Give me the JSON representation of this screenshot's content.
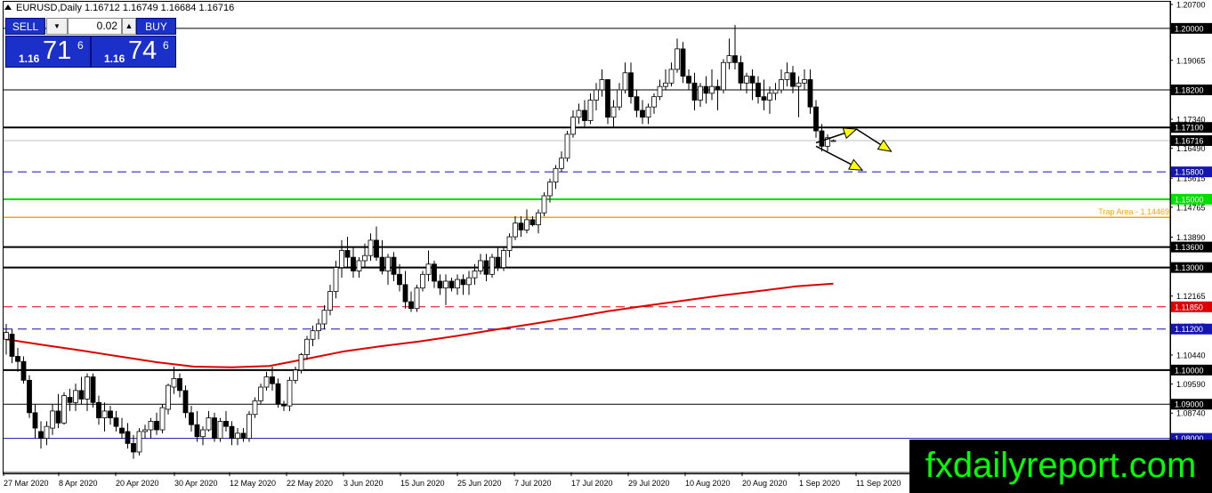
{
  "header": {
    "title": "EURUSD,Daily  1.16712 1.16749 1.16684 1.16716"
  },
  "trade_panel": {
    "sell_label": "SELL",
    "buy_label": "BUY",
    "volume": "0.02",
    "sell_price": {
      "prefix": "1.16",
      "big": "71",
      "sup": "6"
    },
    "buy_price": {
      "prefix": "1.16",
      "big": "74",
      "sup": "6"
    }
  },
  "watermark": "fxdailyreport.com",
  "colors": {
    "candle_stroke": "#000000",
    "ma_line": "#dd0000",
    "green_level": "#00dd00",
    "orange_level": "#ffa500",
    "red_dashed": "#dd0000",
    "blue_dashed": "#1010aa",
    "blue_solid": "#1515b0",
    "current_price_line": "#c0c0c0",
    "arrow_head": "#ffff00",
    "panel_blue": "#1a30c8"
  },
  "chart_data": {
    "type": "candlestick",
    "symbol": "EURUSD",
    "timeframe": "Daily",
    "ylim": [
      1.07,
      1.207
    ],
    "y_ticks": [
      "1.20700",
      "1.19065",
      "1.17340",
      "1.16490",
      "1.15615",
      "1.14765",
      "1.13890",
      "1.12165",
      "1.11285",
      "1.10440",
      "1.09590",
      "1.08740",
      "1.07865"
    ],
    "x_ticks": [
      "27 Mar 2020",
      "8 Apr 2020",
      "20 Apr 2020",
      "30 Apr 2020",
      "12 May 2020",
      "22 May 2020",
      "3 Jun 2020",
      "15 Jun 2020",
      "25 Jun 2020",
      "7 Jul 2020",
      "17 Jul 2020",
      "29 Jul 2020",
      "10 Aug 2020",
      "20 Aug 2020",
      "1 Sep 2020",
      "11 Sep 2020"
    ],
    "levels": [
      {
        "value": 1.2,
        "label": "1.20000",
        "style": "solid",
        "color": "#000000",
        "width": 1,
        "tag_bg": "#000000",
        "tag_fg": "#ffffff"
      },
      {
        "value": 1.182,
        "label": "1.18200",
        "style": "solid",
        "color": "#000000",
        "width": 1,
        "tag_bg": "#000000",
        "tag_fg": "#ffffff"
      },
      {
        "value": 1.171,
        "label": "1.17100",
        "style": "solid",
        "color": "#000000",
        "width": 2,
        "tag_bg": "#000000",
        "tag_fg": "#ffffff"
      },
      {
        "value": 1.16716,
        "label": "1.16716",
        "style": "solid",
        "color": "#c0c0c0",
        "width": 1,
        "tag_bg": "#000000",
        "tag_fg": "#ffffff"
      },
      {
        "value": 1.158,
        "label": "1.15800",
        "style": "dashed",
        "color": "#1010aa",
        "width": 1,
        "tag_bg": "#1515b0",
        "tag_fg": "#ffffff"
      },
      {
        "value": 1.15,
        "label": "1.15000",
        "style": "solid",
        "color": "#00dd00",
        "width": 2,
        "tag_bg": "#00dd00",
        "tag_fg": "#ffffff"
      },
      {
        "value": 1.14469,
        "label": "",
        "style": "solid",
        "color": "#ffa500",
        "width": 1.5,
        "tag_bg": "",
        "tag_fg": ""
      },
      {
        "value": 1.136,
        "label": "1.13600",
        "style": "solid",
        "color": "#000000",
        "width": 2,
        "tag_bg": "#000000",
        "tag_fg": "#ffffff"
      },
      {
        "value": 1.13,
        "label": "1.13000",
        "style": "solid",
        "color": "#000000",
        "width": 2,
        "tag_bg": "#000000",
        "tag_fg": "#ffffff"
      },
      {
        "value": 1.1185,
        "label": "1.11850",
        "style": "dashed",
        "color": "#dd0000",
        "width": 1,
        "tag_bg": "#dd0000",
        "tag_fg": "#ffffff"
      },
      {
        "value": 1.112,
        "label": "1.11200",
        "style": "dashed",
        "color": "#1010aa",
        "width": 1,
        "tag_bg": "#1515b0",
        "tag_fg": "#ffffff"
      },
      {
        "value": 1.1,
        "label": "1.10000",
        "style": "solid",
        "color": "#000000",
        "width": 2,
        "tag_bg": "#000000",
        "tag_fg": "#ffffff"
      },
      {
        "value": 1.09,
        "label": "1.09000",
        "style": "solid",
        "color": "#000000",
        "width": 1,
        "tag_bg": "#000000",
        "tag_fg": "#ffffff"
      },
      {
        "value": 1.08,
        "label": "1.08000",
        "style": "solid",
        "color": "#1515b0",
        "width": 1,
        "tag_bg": "#1515b0",
        "tag_fg": "#ffffff"
      }
    ],
    "annotation": {
      "text": "Trap Area - 1.14469",
      "color": "#ffa500"
    },
    "candles": [
      [
        1.109,
        1.1135,
        1.1045,
        1.111
      ],
      [
        1.1105,
        1.112,
        1.102,
        1.104
      ],
      [
        1.104,
        1.1065,
        1.0995,
        1.1025
      ],
      [
        1.1025,
        1.104,
        1.096,
        1.097
      ],
      [
        1.097,
        1.0985,
        1.086,
        1.0875
      ],
      [
        1.0875,
        1.09,
        1.08,
        1.083
      ],
      [
        1.082,
        1.085,
        1.077,
        1.08
      ],
      [
        1.08,
        1.085,
        1.078,
        1.0835
      ],
      [
        1.083,
        1.09,
        1.081,
        1.088
      ],
      [
        1.088,
        1.093,
        1.083,
        1.0845
      ],
      [
        1.0845,
        1.0935,
        1.084,
        1.0925
      ],
      [
        1.092,
        1.0945,
        1.088,
        1.0905
      ],
      [
        1.0905,
        1.096,
        1.088,
        1.094
      ],
      [
        1.094,
        1.098,
        1.09,
        1.0915
      ],
      [
        1.0915,
        1.099,
        1.088,
        1.098
      ],
      [
        1.098,
        1.099,
        1.089,
        1.0905
      ],
      [
        1.0905,
        1.0925,
        1.084,
        1.086
      ],
      [
        1.086,
        1.0905,
        1.082,
        1.088
      ],
      [
        1.088,
        1.0895,
        1.084,
        1.086
      ],
      [
        1.086,
        1.088,
        1.082,
        1.0835
      ],
      [
        1.083,
        1.086,
        1.08,
        1.0815
      ],
      [
        1.082,
        1.0845,
        1.077,
        1.0785
      ],
      [
        1.0785,
        1.081,
        1.074,
        1.076
      ],
      [
        1.076,
        1.083,
        1.075,
        1.082
      ],
      [
        1.082,
        1.084,
        1.08,
        1.0825
      ],
      [
        1.0825,
        1.086,
        1.08,
        1.085
      ],
      [
        1.085,
        1.0875,
        1.081,
        1.0825
      ],
      [
        1.0825,
        1.09,
        1.0815,
        1.089
      ],
      [
        1.0885,
        1.096,
        1.087,
        1.0955
      ],
      [
        1.095,
        1.101,
        1.093,
        1.0975
      ],
      [
        1.0975,
        1.099,
        1.092,
        1.094
      ],
      [
        1.094,
        1.0955,
        1.086,
        1.0875
      ],
      [
        1.0875,
        1.0895,
        1.082,
        1.084
      ],
      [
        1.084,
        1.088,
        1.079,
        1.0805
      ],
      [
        1.0805,
        1.0835,
        1.078,
        1.0825
      ],
      [
        1.0825,
        1.088,
        1.082,
        1.086
      ],
      [
        1.086,
        1.0875,
        1.079,
        1.08
      ],
      [
        1.08,
        1.086,
        1.079,
        1.085
      ],
      [
        1.085,
        1.088,
        1.082,
        1.0835
      ],
      [
        1.0835,
        1.085,
        1.078,
        1.08
      ],
      [
        1.08,
        1.083,
        1.078,
        1.0815
      ],
      [
        1.0815,
        1.083,
        1.079,
        1.08
      ],
      [
        1.08,
        1.088,
        1.079,
        1.087
      ],
      [
        1.087,
        1.092,
        1.086,
        1.091
      ],
      [
        1.091,
        1.096,
        1.09,
        1.095
      ],
      [
        1.095,
        1.0995,
        1.094,
        1.098
      ],
      [
        1.098,
        1.101,
        1.094,
        1.096
      ],
      [
        1.096,
        1.0975,
        1.089,
        1.09
      ],
      [
        1.09,
        1.091,
        1.088,
        1.0895
      ],
      [
        1.0895,
        1.098,
        1.088,
        1.097
      ],
      [
        1.097,
        1.101,
        1.096,
        1.1
      ],
      [
        1.1,
        1.105,
        1.099,
        1.1045
      ],
      [
        1.1045,
        1.11,
        1.103,
        1.109
      ],
      [
        1.109,
        1.113,
        1.107,
        1.1115
      ],
      [
        1.1115,
        1.115,
        1.109,
        1.1135
      ],
      [
        1.1135,
        1.119,
        1.112,
        1.1175
      ],
      [
        1.1175,
        1.125,
        1.116,
        1.123
      ],
      [
        1.123,
        1.132,
        1.121,
        1.13
      ],
      [
        1.13,
        1.138,
        1.127,
        1.135
      ],
      [
        1.135,
        1.139,
        1.13,
        1.133
      ],
      [
        1.133,
        1.136,
        1.127,
        1.129
      ],
      [
        1.129,
        1.133,
        1.127,
        1.132
      ],
      [
        1.132,
        1.137,
        1.13,
        1.1335
      ],
      [
        1.1335,
        1.14,
        1.132,
        1.138
      ],
      [
        1.138,
        1.142,
        1.132,
        1.133
      ],
      [
        1.133,
        1.138,
        1.128,
        1.129
      ],
      [
        1.129,
        1.134,
        1.125,
        1.133
      ],
      [
        1.133,
        1.1345,
        1.126,
        1.128
      ],
      [
        1.128,
        1.131,
        1.123,
        1.125
      ],
      [
        1.125,
        1.129,
        1.118,
        1.12
      ],
      [
        1.12,
        1.123,
        1.117,
        1.118
      ],
      [
        1.118,
        1.125,
        1.117,
        1.124
      ],
      [
        1.124,
        1.129,
        1.123,
        1.128
      ],
      [
        1.128,
        1.135,
        1.126,
        1.131
      ],
      [
        1.131,
        1.132,
        1.124,
        1.126
      ],
      [
        1.126,
        1.128,
        1.122,
        1.124
      ],
      [
        1.124,
        1.128,
        1.119,
        1.126
      ],
      [
        1.126,
        1.127,
        1.123,
        1.124
      ],
      [
        1.124,
        1.128,
        1.122,
        1.1265
      ],
      [
        1.1265,
        1.128,
        1.122,
        1.125
      ],
      [
        1.125,
        1.129,
        1.122,
        1.127
      ],
      [
        1.127,
        1.131,
        1.125,
        1.129
      ],
      [
        1.129,
        1.134,
        1.128,
        1.132
      ],
      [
        1.132,
        1.134,
        1.126,
        1.128
      ],
      [
        1.128,
        1.134,
        1.127,
        1.133
      ],
      [
        1.133,
        1.136,
        1.129,
        1.13
      ],
      [
        1.13,
        1.136,
        1.129,
        1.135
      ],
      [
        1.135,
        1.14,
        1.133,
        1.139
      ],
      [
        1.139,
        1.145,
        1.138,
        1.143
      ],
      [
        1.143,
        1.145,
        1.139,
        1.141
      ],
      [
        1.141,
        1.147,
        1.14,
        1.144
      ],
      [
        1.144,
        1.145,
        1.142,
        1.1425
      ],
      [
        1.1425,
        1.147,
        1.14,
        1.146
      ],
      [
        1.146,
        1.152,
        1.145,
        1.151
      ],
      [
        1.151,
        1.156,
        1.149,
        1.155
      ],
      [
        1.155,
        1.16,
        1.153,
        1.159
      ],
      [
        1.159,
        1.164,
        1.158,
        1.162
      ],
      [
        1.162,
        1.17,
        1.161,
        1.169
      ],
      [
        1.169,
        1.176,
        1.168,
        1.174
      ],
      [
        1.174,
        1.178,
        1.172,
        1.176
      ],
      [
        1.176,
        1.179,
        1.171,
        1.173
      ],
      [
        1.173,
        1.181,
        1.172,
        1.179
      ],
      [
        1.179,
        1.184,
        1.176,
        1.182
      ],
      [
        1.182,
        1.188,
        1.18,
        1.185
      ],
      [
        1.185,
        1.185,
        1.172,
        1.174
      ],
      [
        1.174,
        1.179,
        1.171,
        1.177
      ],
      [
        1.177,
        1.184,
        1.176,
        1.182
      ],
      [
        1.182,
        1.19,
        1.181,
        1.187
      ],
      [
        1.187,
        1.19,
        1.178,
        1.18
      ],
      [
        1.18,
        1.182,
        1.174,
        1.176
      ],
      [
        1.176,
        1.179,
        1.172,
        1.174
      ],
      [
        1.174,
        1.178,
        1.172,
        1.177
      ],
      [
        1.177,
        1.181,
        1.175,
        1.18
      ],
      [
        1.18,
        1.185,
        1.179,
        1.183
      ],
      [
        1.183,
        1.188,
        1.182,
        1.184
      ],
      [
        1.184,
        1.19,
        1.183,
        1.188
      ],
      [
        1.188,
        1.197,
        1.187,
        1.194
      ],
      [
        1.194,
        1.196,
        1.184,
        1.186
      ],
      [
        1.186,
        1.188,
        1.182,
        1.184
      ],
      [
        1.184,
        1.187,
        1.176,
        1.179
      ],
      [
        1.179,
        1.184,
        1.177,
        1.183
      ],
      [
        1.183,
        1.186,
        1.178,
        1.181
      ],
      [
        1.181,
        1.188,
        1.179,
        1.183
      ],
      [
        1.183,
        1.185,
        1.176,
        1.182
      ],
      [
        1.182,
        1.191,
        1.181,
        1.19
      ],
      [
        1.19,
        1.197,
        1.188,
        1.192
      ],
      [
        1.192,
        1.201,
        1.188,
        1.19
      ],
      [
        1.19,
        1.192,
        1.182,
        1.184
      ],
      [
        1.184,
        1.187,
        1.181,
        1.186
      ],
      [
        1.186,
        1.188,
        1.179,
        1.184
      ],
      [
        1.184,
        1.186,
        1.178,
        1.18
      ],
      [
        1.18,
        1.185,
        1.176,
        1.179
      ],
      [
        1.179,
        1.183,
        1.175,
        1.181
      ],
      [
        1.181,
        1.184,
        1.179,
        1.182
      ],
      [
        1.182,
        1.188,
        1.181,
        1.185
      ],
      [
        1.185,
        1.19,
        1.183,
        1.187
      ],
      [
        1.187,
        1.189,
        1.181,
        1.183
      ],
      [
        1.183,
        1.186,
        1.174,
        1.184
      ],
      [
        1.184,
        1.188,
        1.182,
        1.185
      ],
      [
        1.185,
        1.188,
        1.175,
        1.177
      ],
      [
        1.177,
        1.179,
        1.168,
        1.17
      ],
      [
        1.17,
        1.172,
        1.164,
        1.1655
      ],
      [
        1.1655,
        1.169,
        1.164,
        1.168
      ],
      [
        1.16712,
        1.16749,
        1.16684,
        1.16716
      ]
    ],
    "ma": [
      1.109,
      1.1073,
      1.1057,
      1.104,
      1.1023,
      1.101,
      1.1008,
      1.1012,
      1.1033,
      1.1055,
      1.107,
      1.1084,
      1.11,
      1.1118,
      1.1135,
      1.1153,
      1.1172,
      1.1188,
      1.1203,
      1.1218,
      1.1231,
      1.1245,
      1.1253
    ],
    "annotation_arrows": [
      {
        "from": [
          140,
          1.1665
        ],
        "to": [
          147,
          1.1705
        ]
      },
      {
        "from": [
          147,
          1.1705
        ],
        "to": [
          153,
          1.164
        ]
      },
      {
        "from": [
          140,
          1.1655
        ],
        "to": [
          148,
          1.1585
        ]
      }
    ]
  }
}
